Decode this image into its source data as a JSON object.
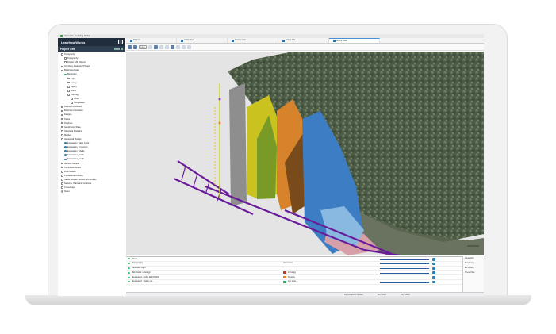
{
  "window": {
    "title": "Geoworks - Leapfrog Works"
  },
  "brand": {
    "name": "Leapfrog Works"
  },
  "tree": {
    "title": "Project Tree",
    "items": [
      {
        "label": "Topography",
        "indent": 0,
        "icon": "box"
      },
      {
        "label": "Topography",
        "indent": 1,
        "icon": "box"
      },
      {
        "label": "Project GIS Objects",
        "indent": 1,
        "icon": "box"
      },
      {
        "label": "GIS Data, Maps and Photos",
        "indent": 0,
        "icon": "box"
      },
      {
        "label": "Boreholes Data",
        "indent": 0,
        "icon": "box"
      },
      {
        "label": "Boreholes",
        "indent": 1,
        "icon": "grn"
      },
      {
        "label": "collar",
        "indent": 2,
        "icon": "box"
      },
      {
        "label": "survey",
        "indent": 2,
        "icon": "box"
      },
      {
        "label": "Layers",
        "indent": 2,
        "icon": "box"
      },
      {
        "label": "points",
        "indent": 2,
        "icon": "box"
      },
      {
        "label": "Lithology",
        "indent": 2,
        "icon": "box"
      },
      {
        "label": "Units",
        "indent": 3,
        "icon": "box"
      },
      {
        "label": "Composites",
        "indent": 3,
        "icon": "box"
      },
      {
        "label": "Planned Boreholes",
        "indent": 0,
        "icon": "box"
      },
      {
        "label": "Borehole Correlation",
        "indent": 0,
        "icon": "box"
      },
      {
        "label": "Designs",
        "indent": 0,
        "icon": "box"
      },
      {
        "label": "Points",
        "indent": 0,
        "icon": "box"
      },
      {
        "label": "Polylines",
        "indent": 0,
        "icon": "box"
      },
      {
        "label": "Geophysical Data",
        "indent": 0,
        "icon": "box"
      },
      {
        "label": "Structural Modelling",
        "indent": 0,
        "icon": "box"
      },
      {
        "label": "Meshes",
        "indent": 0,
        "icon": "box"
      },
      {
        "label": "Geological Models",
        "indent": 0,
        "icon": "box"
      },
      {
        "label": "Excavation_Stem Cycle",
        "indent": 1,
        "icon": "geo"
      },
      {
        "label": "Excavation_UnTunnel",
        "indent": 1,
        "icon": "geo"
      },
      {
        "label": "Excavation_Shafts",
        "indent": 1,
        "icon": "geo"
      },
      {
        "label": "Excavation_North",
        "indent": 1,
        "icon": "geo"
      },
      {
        "label": "Excavation_South",
        "indent": 1,
        "icon": "geo"
      },
      {
        "label": "Numeric Models",
        "indent": 0,
        "icon": "box"
      },
      {
        "label": "Combined Models",
        "indent": 0,
        "icon": "box"
      },
      {
        "label": "Flow Models",
        "indent": 0,
        "icon": "box"
      },
      {
        "label": "Contaminant Models",
        "indent": 0,
        "icon": "box"
      },
      {
        "label": "Saved Scenes, Movies and Models",
        "indent": 0,
        "icon": "box"
      },
      {
        "label": "Sections, Plans and Contours",
        "indent": 0,
        "icon": "box"
      },
      {
        "label": "Colourmaps",
        "indent": 0,
        "icon": "box"
      },
      {
        "label": "Notes",
        "indent": 0,
        "icon": "gry"
      }
    ]
  },
  "tabs": [
    {
      "label": "Polaron",
      "active": false
    },
    {
      "label": "Cable Area",
      "active": false
    },
    {
      "label": "Fluorometer",
      "active": false
    },
    {
      "label": "Scene File",
      "active": false
    },
    {
      "label": "Scene View",
      "active": true
    }
  ],
  "toolbar": {
    "look_label": "Look"
  },
  "bottom": {
    "rows": [
      {
        "label": "Slicer",
        "mid": "",
        "swatch": ""
      },
      {
        "label": "Topography",
        "mid": "Unit colour",
        "swatch": ""
      },
      {
        "label": "Shadows  Light",
        "mid": "",
        "swatch": ""
      },
      {
        "label": "Boreholes: Lithology",
        "mid": "Lithology",
        "swatch": "#c0392b"
      },
      {
        "label": "Excavation_EXD...ALINTERA",
        "mid": "Porosity",
        "swatch": "#e67e22"
      },
      {
        "label": "Excavation_Shafts: clo",
        "mid": "Lith rows",
        "swatch": "#27ae60"
      }
    ],
    "right_col": [
      "Geoworks",
      "Boreholes",
      "Ex Global",
      "Scene Files"
    ]
  },
  "status": {
    "coord_system": "No Coordinate System",
    "mode": "Full Screen",
    "fps": "Run Code"
  },
  "colors": {
    "brand_bg": "#1f2d3d",
    "accent": "#4a90d9",
    "borehole_purple": "#6a1b9a"
  }
}
